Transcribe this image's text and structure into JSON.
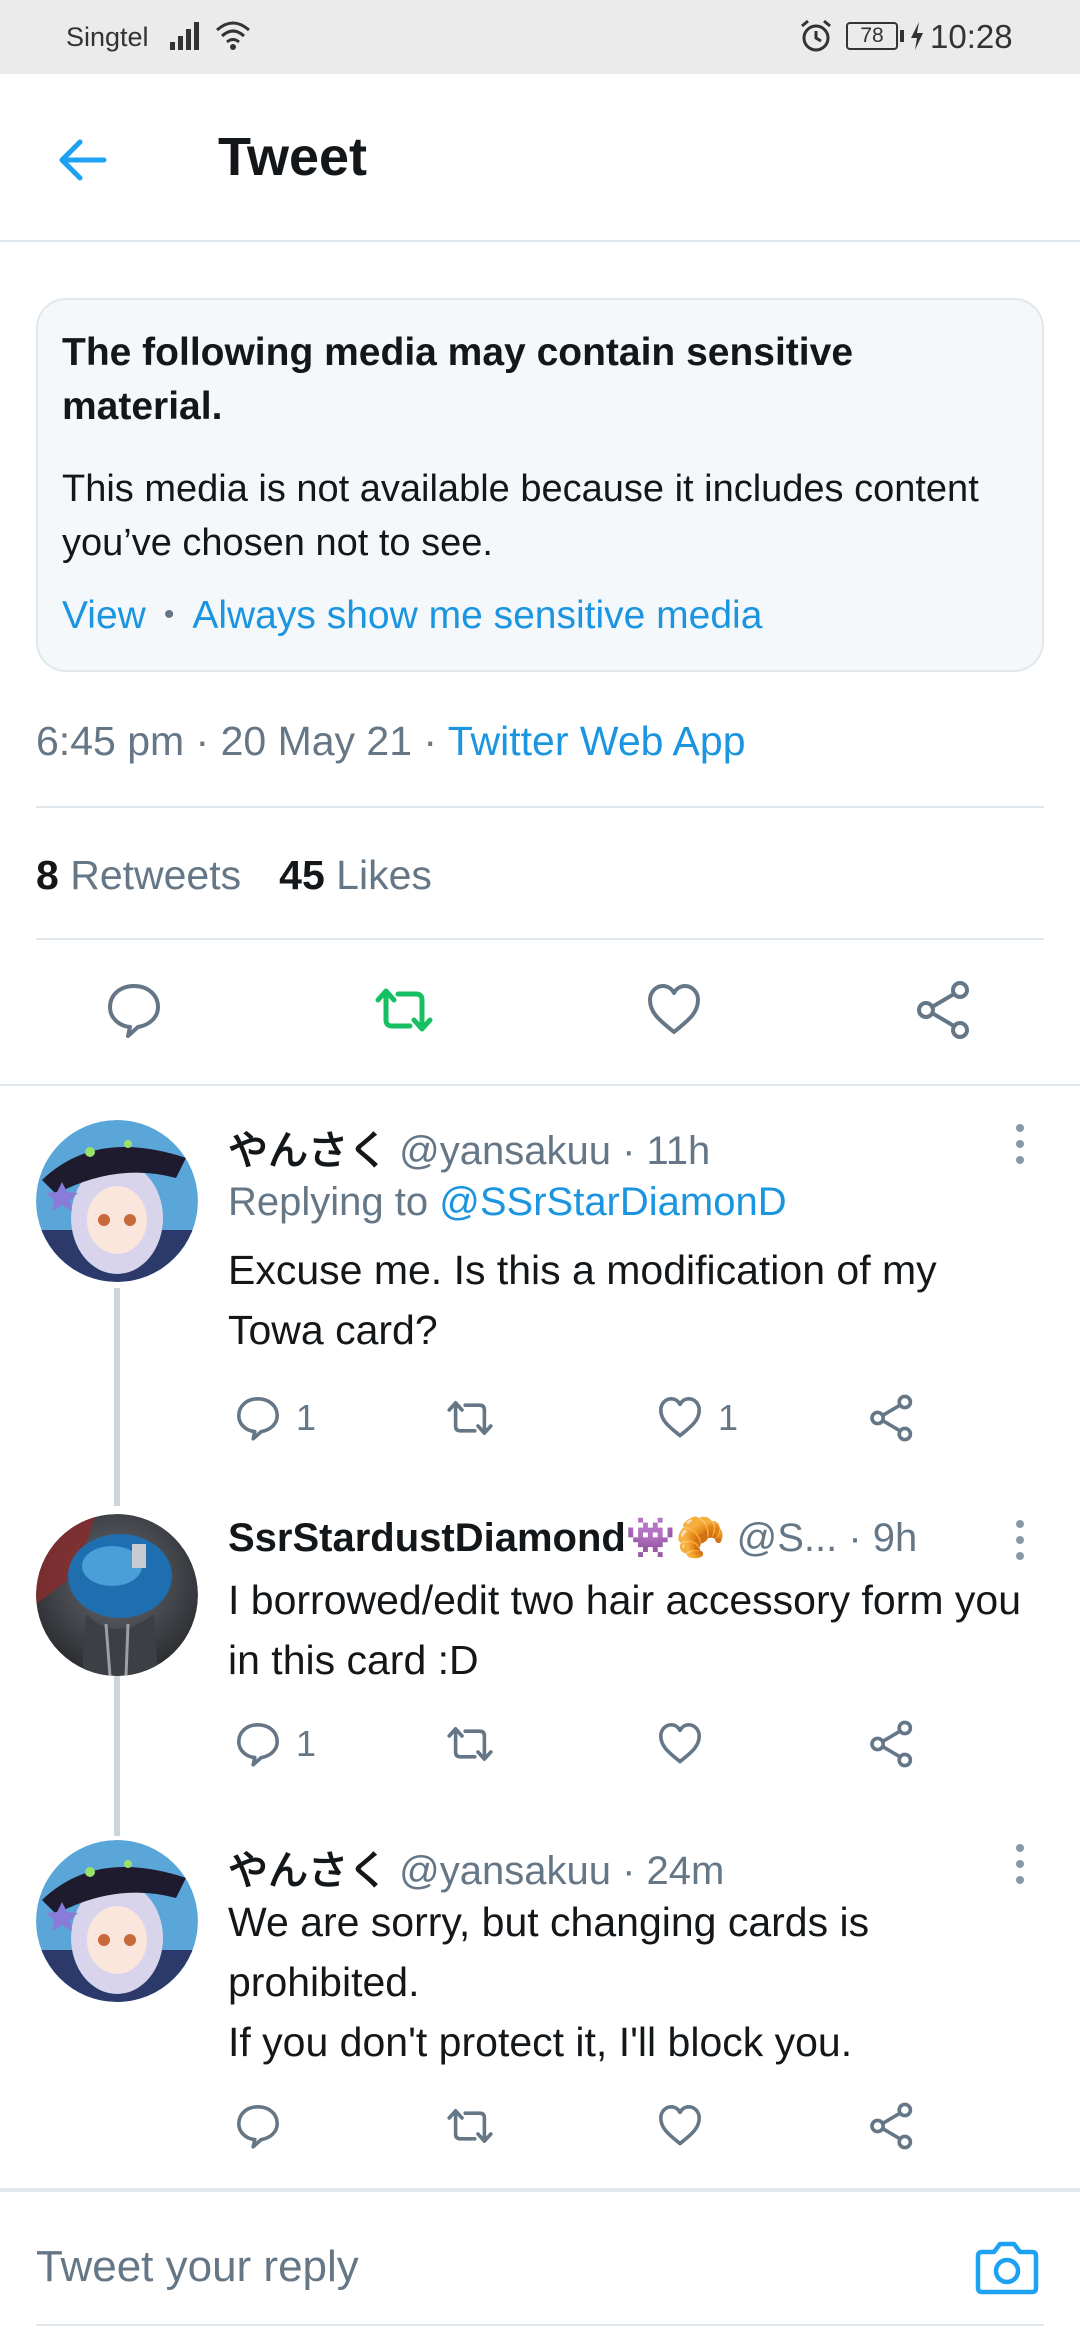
{
  "status_bar": {
    "carrier": "Singtel",
    "battery": "78",
    "time": "10:28"
  },
  "header": {
    "title": "Tweet"
  },
  "sensitive": {
    "title": "The following media may contain sensitive material.",
    "body": "This media is not available because it includes content you’ve chosen not to see.",
    "view_label": "View",
    "separator": "•",
    "always_label": "Always show me sensitive media"
  },
  "meta": {
    "time_date": "6:45 pm · 20 May 21 · ",
    "app": "Twitter Web App"
  },
  "stats": {
    "retweets_count": "8",
    "retweets_label": "Retweets",
    "likes_count": "45",
    "likes_label": "Likes"
  },
  "replies": [
    {
      "name": "やんさく",
      "handle_time": "@yansakuu · 11h",
      "replying_prefix": "Replying to ",
      "replying_to": "@SSrStarDiamonD",
      "text": "Excuse me. Is this a modification of my Towa card?",
      "reply_count": "1",
      "retweet_count": "",
      "like_count": "1"
    },
    {
      "name": "SsrStardustDiamond",
      "emoji": "👾🥐",
      "handle_time": "@S...  · 9h",
      "text": "I borrowed/edit two hair accessory form you in this card :D",
      "reply_count": "1",
      "retweet_count": "",
      "like_count": ""
    },
    {
      "name": "やんさく",
      "handle_time": "@yansakuu · 24m",
      "text": "We are sorry, but changing cards is prohibited.\nIf you don't protect it, I'll block you.",
      "reply_count": "",
      "retweet_count": "",
      "like_count": ""
    }
  ],
  "composer": {
    "placeholder": "Tweet your reply"
  },
  "colors": {
    "accent": "#1b95e0",
    "retweet_active": "#17bf63",
    "secondary_text": "#657786"
  }
}
